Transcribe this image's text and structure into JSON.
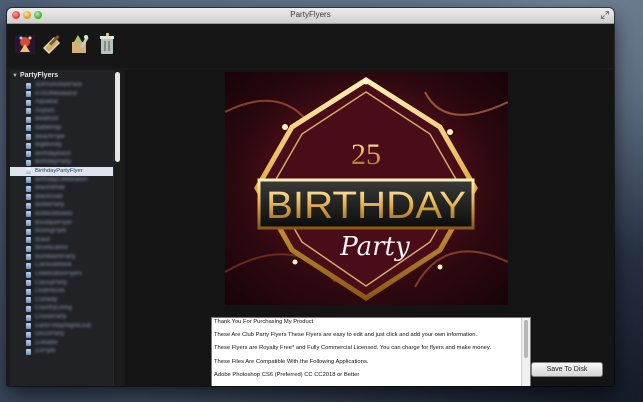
{
  "window": {
    "title": "PartyFlyers"
  },
  "toolbar": {
    "buttons": [
      {
        "icon": "flyer-app-icon",
        "color": "#c33a2a"
      },
      {
        "icon": "edit-flyer-icon",
        "color": "#d8b26a"
      },
      {
        "icon": "tools-icon",
        "color": "#6b8f3a"
      },
      {
        "icon": "trash-icon",
        "color": "#9ab0a0"
      }
    ]
  },
  "sidebar": {
    "header": "PartyFlyers",
    "items": [
      "3DProActionPack",
      "4ThOfWeekend",
      "AquaBar",
      "Asylum",
      "BeatKick",
      "BattleRap",
      "BeachFlyer",
      "BigMoney",
      "BirthdayBash",
      "BirthdayParty",
      "BirthdayPartyFlyer",
      "BirthdayCelebration",
      "BlackWhite",
      "BlackGold",
      "BottleParty",
      "BottlesModels",
      "BoutiqueFlyer",
      "BoxingFlyer",
      "Brasil",
      "BrushDance",
      "BurnBashParty",
      "CarnivalMask",
      "CelebrationFlyers",
      "ClassyParty",
      "ClubHouse",
      "Comedy",
      "CountryLiving",
      "CruiseParty",
      "DarkFridayNightClub",
      "DiscoParty",
      "DJBattle",
      "DJFlyer"
    ],
    "selected_index": 10
  },
  "description": {
    "lines": [
      "Thank You For Purchasing My Product",
      "These Are Club Party Flyers These Flyers are easy to edit and just click and add your own information.",
      "These Flyers are Royalty Free* and Fully Commercial Licensed. You can charge for flyers and make money.",
      "These Files Are Compatible With the Following Applications.",
      "Adobe Photoshop CS6 (Preferred) CC CC2018 or Better"
    ]
  },
  "save_button": {
    "label": "Save To Disk"
  },
  "flyer": {
    "number": "25",
    "headline": "BIRTHDAY",
    "script": "Party"
  }
}
